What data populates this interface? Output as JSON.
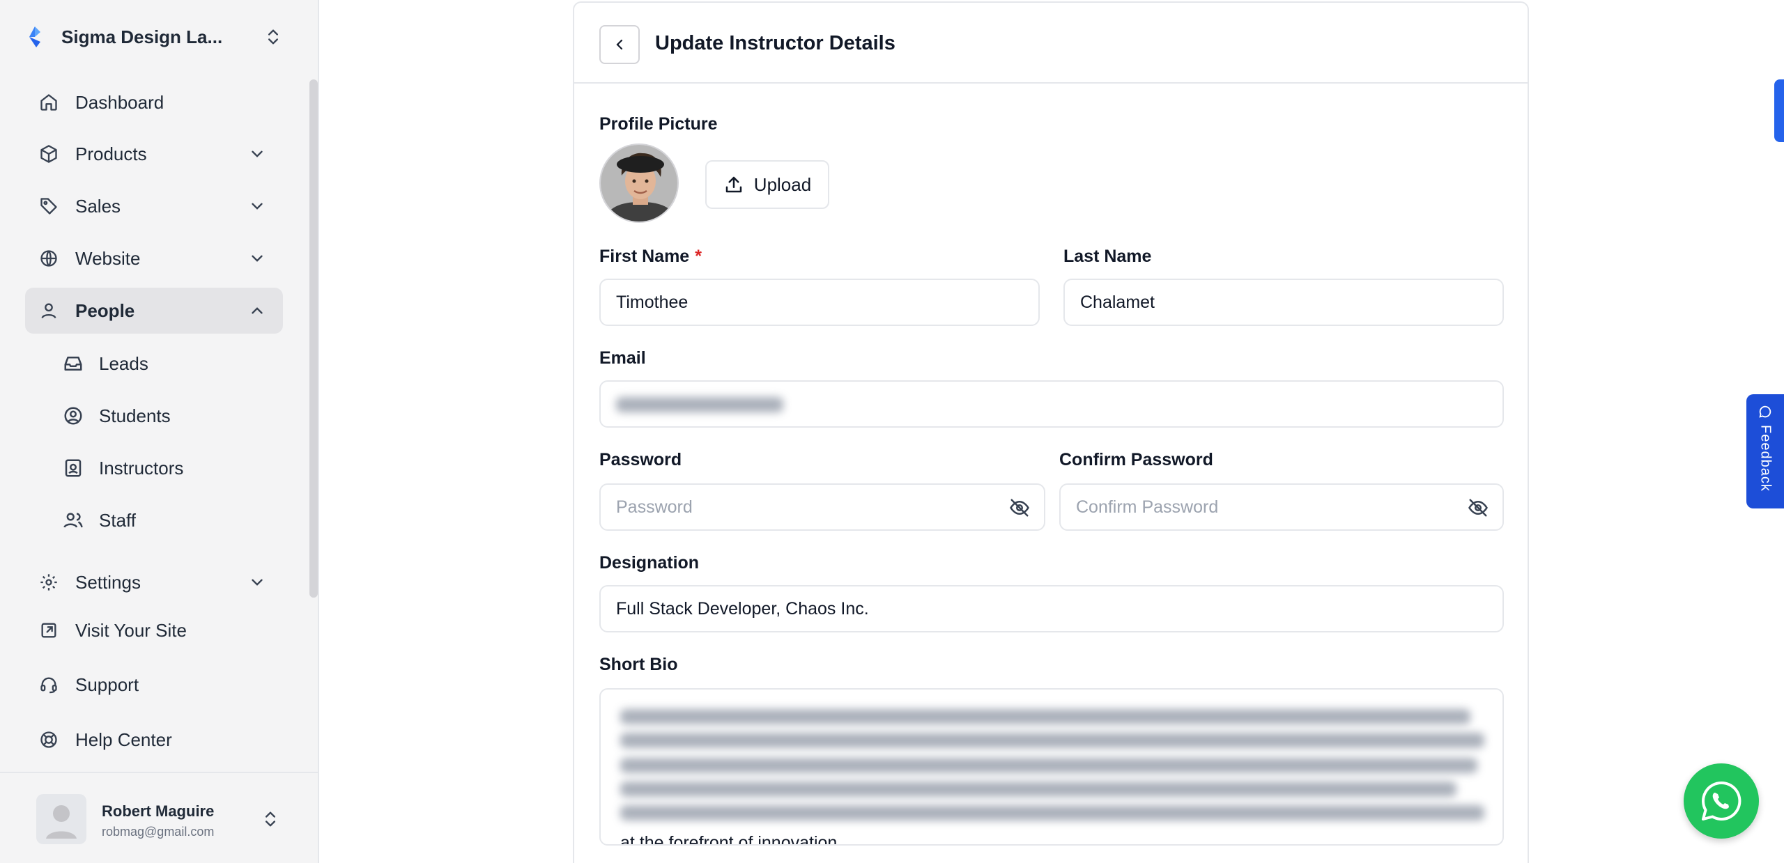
{
  "org": {
    "name": "Sigma Design La..."
  },
  "nav": {
    "dashboard": "Dashboard",
    "products": "Products",
    "sales": "Sales",
    "website": "Website",
    "people": "People",
    "leads": "Leads",
    "students": "Students",
    "instructors": "Instructors",
    "staff": "Staff",
    "settings": "Settings",
    "visit_site": "Visit Your Site",
    "support": "Support",
    "help_center": "Help Center"
  },
  "user": {
    "name": "Robert Maguire",
    "email": "robmag@gmail.com"
  },
  "form": {
    "title": "Update Instructor Details",
    "profile_picture_label": "Profile Picture",
    "upload_label": "Upload",
    "first_name_label": "First Name",
    "required_mark": "*",
    "first_name_value": "Timothee",
    "last_name_label": "Last Name",
    "last_name_value": "Chalamet",
    "email_label": "Email",
    "password_label": "Password",
    "password_placeholder": "Password",
    "confirm_password_label": "Confirm Password",
    "confirm_password_placeholder": "Confirm Password",
    "designation_label": "Designation",
    "designation_value": "Full Stack Developer, Chaos Inc.",
    "short_bio_label": "Short Bio",
    "short_bio_visible_tail": "at the forefront of innovation."
  },
  "feedback_label": "Feedback",
  "colors": {
    "accent": "#2563eb",
    "whatsapp": "#22c55e",
    "required": "#dc2626"
  }
}
